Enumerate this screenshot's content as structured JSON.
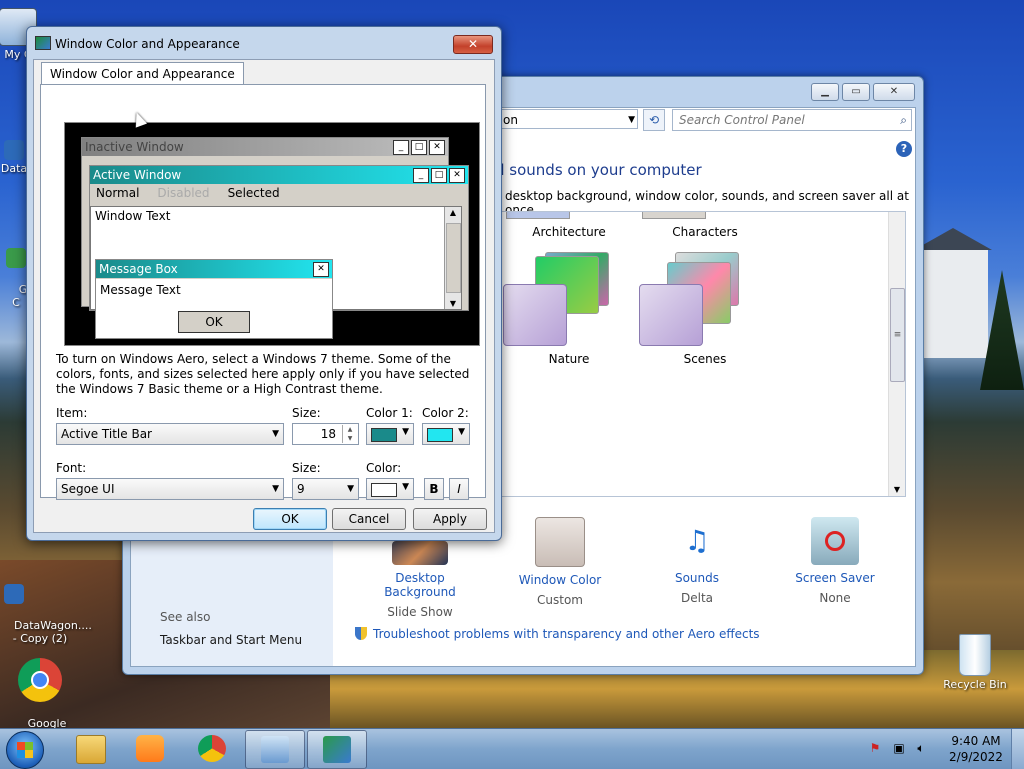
{
  "desktop": {
    "icons": [
      {
        "label": "My C",
        "name": "my-computer"
      },
      {
        "label": "Data",
        "name": "datawagon-shortcut"
      },
      {
        "label": "G\nC",
        "name": "shortcut-g"
      },
      {
        "label": "DataWagon....\n- Copy (2)",
        "name": "datawagon-copy-2"
      },
      {
        "label": "Google\nChrom...",
        "name": "google-chrome"
      },
      {
        "label": "Recycle Bin",
        "name": "recycle-bin"
      }
    ]
  },
  "control_panel": {
    "address": "on",
    "search_placeholder": "Search Control Panel",
    "heading": "d sounds on your computer",
    "description": "desktop background, window color, sounds, and screen saver all at once.",
    "themes": [
      {
        "label": "Architecture"
      },
      {
        "label": "Characters"
      },
      {
        "label": "Nature"
      },
      {
        "label": "Scenes"
      }
    ],
    "bottom_items": [
      {
        "title": "Desktop Background",
        "sub": "Slide Show"
      },
      {
        "title": "Window Color",
        "sub": "Custom"
      },
      {
        "title": "Sounds",
        "sub": "Delta"
      },
      {
        "title": "Screen Saver",
        "sub": "None"
      }
    ],
    "see_also": "See also",
    "taskbar_link": "Taskbar and Start Menu",
    "troubleshoot": "Troubleshoot problems with transparency and other Aero effects"
  },
  "dialog": {
    "title": "Window Color and Appearance",
    "tab": "Window Color and Appearance",
    "preview": {
      "inactive_title": "Inactive Window",
      "active_title": "Active Window",
      "menu_normal": "Normal",
      "menu_disabled": "Disabled",
      "menu_selected": "Selected",
      "window_text": "Window Text",
      "msgbox_title": "Message Box",
      "msgbox_text": "Message Text",
      "ok": "OK"
    },
    "info": "To turn on Windows Aero, select a Windows 7 theme.  Some of the colors, fonts, and sizes selected here apply only if you have selected the Windows 7 Basic theme or a High Contrast theme.",
    "item_label": "Item:",
    "item_value": "Active Title Bar",
    "size_label": "Size:",
    "size_value": "18",
    "color1_label": "Color 1:",
    "color2_label": "Color 2:",
    "color1": "#1a8a8a",
    "color2": "#22e6f0",
    "font_label": "Font:",
    "font_value": "Segoe UI",
    "font_size_label": "Size:",
    "font_size_value": "9",
    "font_color_label": "Color:",
    "font_color": "#ffffff",
    "bold": "B",
    "italic": "I",
    "ok": "OK",
    "cancel": "Cancel",
    "apply": "Apply"
  },
  "taskbar": {
    "clock_time": "9:40 AM",
    "clock_date": "2/9/2022"
  }
}
